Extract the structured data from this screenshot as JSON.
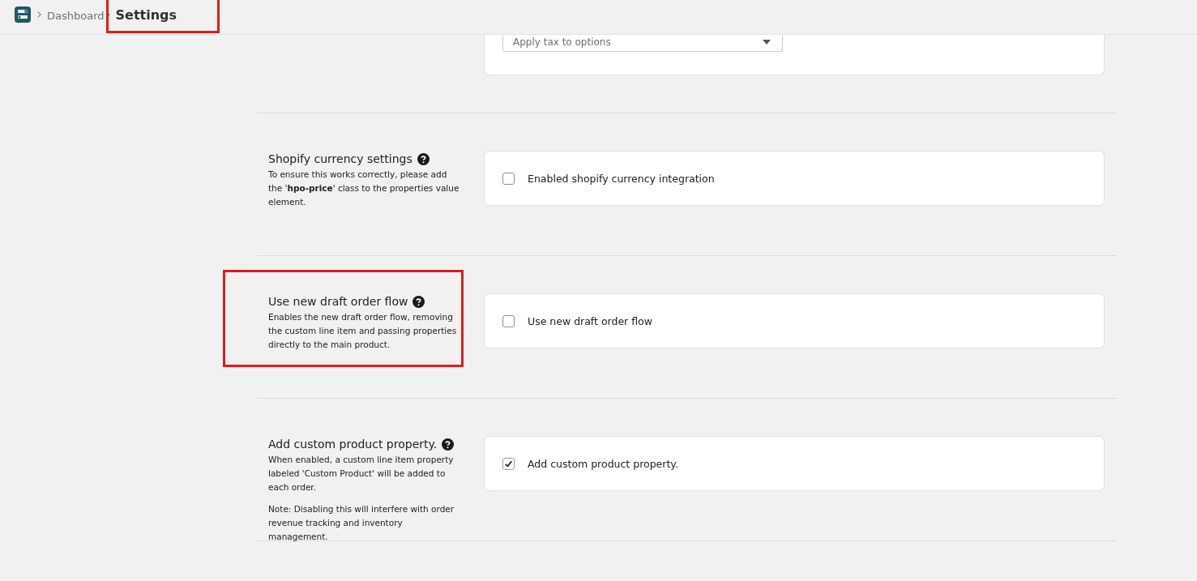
{
  "breadcrumb": [
    {
      "label": "Dashboard",
      "current": false,
      "highlighted": false
    },
    {
      "label": "Settings",
      "current": true,
      "highlighted": true
    }
  ],
  "sections": [
    {
      "kind": "select",
      "placeholder": "Apply tax to options"
    },
    {
      "kind": "checkbox",
      "title": "Shopify currency settings",
      "highlighted": false,
      "description": [
        "To ensure this works correctly, please add the '**hpo-price**' class to the properties value element."
      ],
      "option": {
        "label": "Enabled shopify currency integration",
        "checked": false
      }
    },
    {
      "kind": "checkbox",
      "title": "Use new draft order flow",
      "highlighted": true,
      "description": [
        "Enables the new draft order flow, removing the custom line item and passing properties directly to the main product."
      ],
      "option": {
        "label": "Use new draft order flow",
        "checked": false
      }
    },
    {
      "kind": "checkbox",
      "title": "Add custom product property.",
      "highlighted": false,
      "description": [
        "When enabled, a custom line item property labeled 'Custom Product' will be added to each order.",
        "Note: Disabling this will interfere with order revenue tracking and inventory management."
      ],
      "option": {
        "label": "Add custom product property.",
        "checked": true
      }
    }
  ]
}
